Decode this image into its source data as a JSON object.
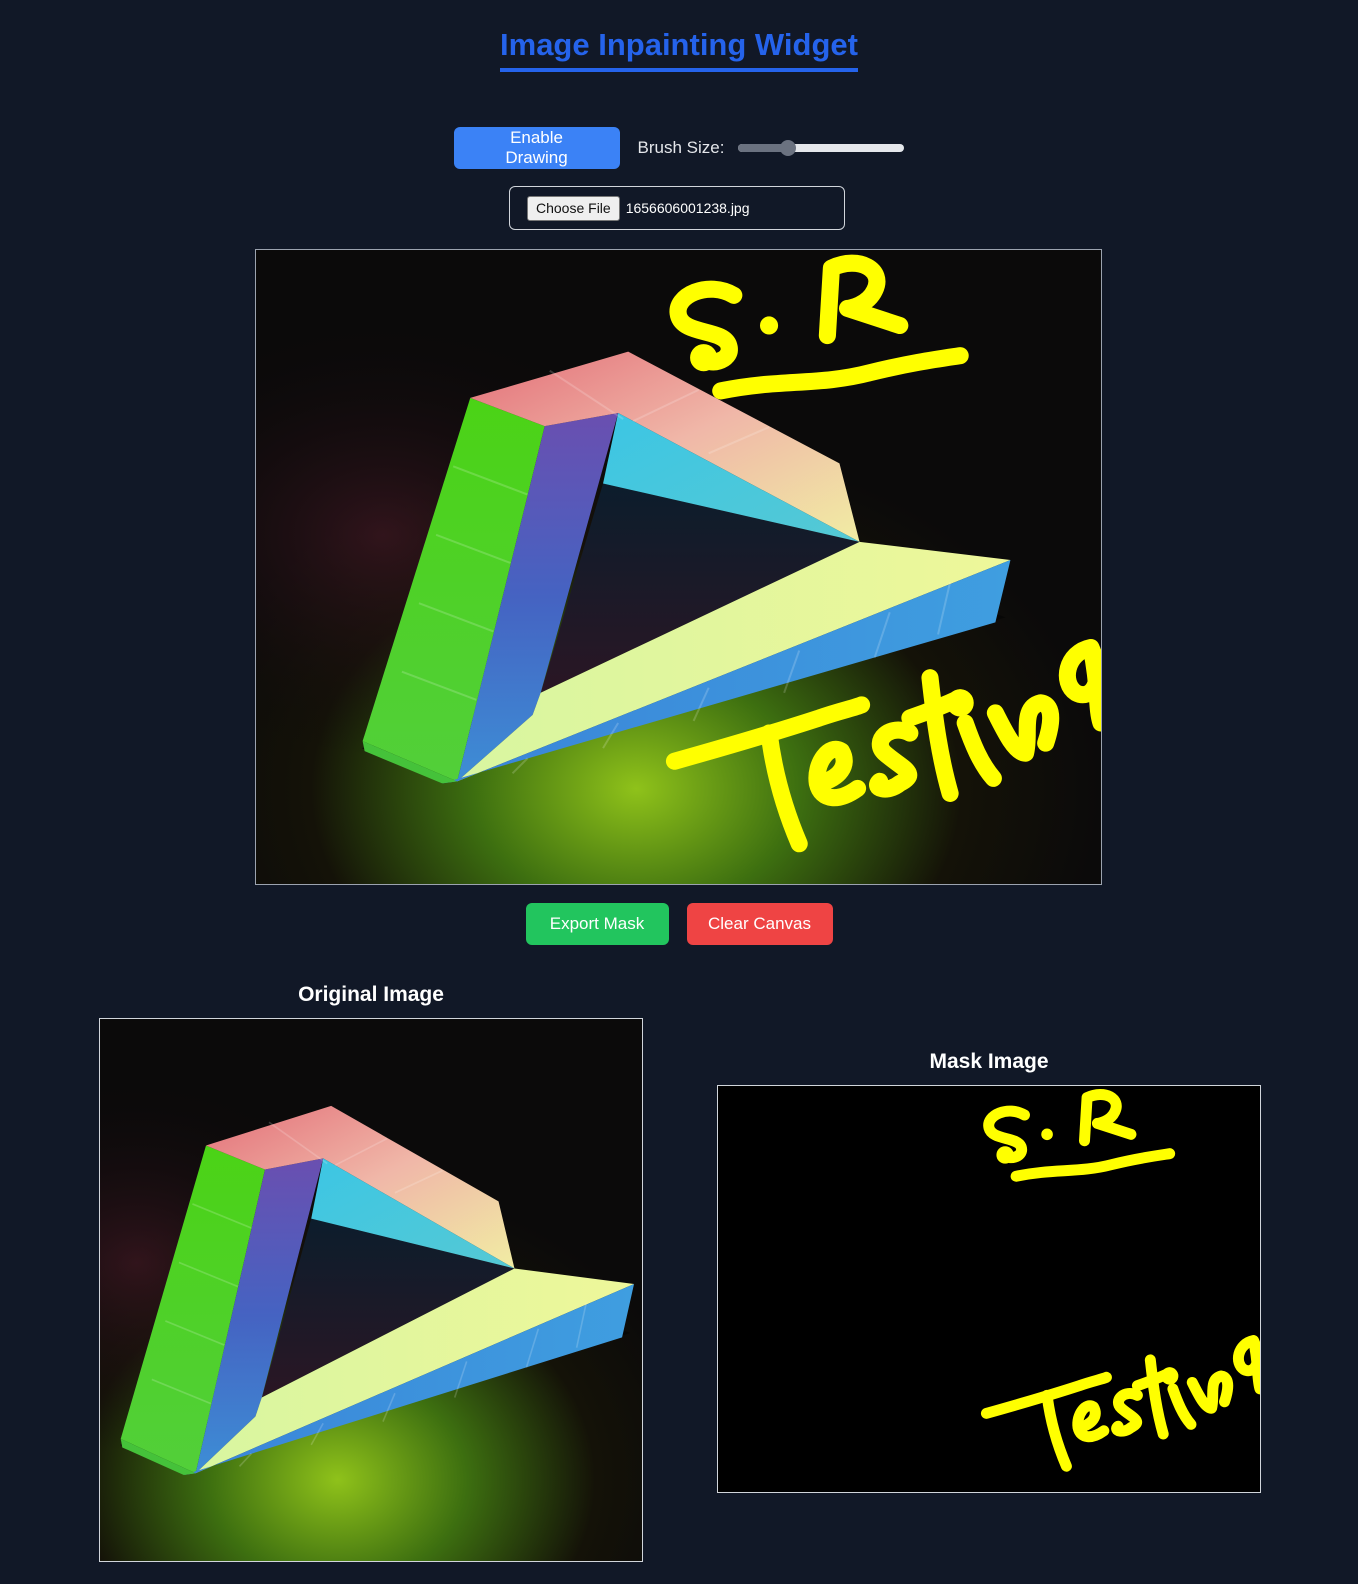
{
  "page": {
    "title": "Image Inpainting Widget"
  },
  "toolbar": {
    "enable_drawing_label": "Enable Drawing",
    "brush_size_label": "Brush Size:",
    "brush_size_fraction": 0.28
  },
  "file_input": {
    "button_label": "Choose File",
    "file_name": "1656606001238.jpg"
  },
  "canvas": {
    "drawn_text": [
      "S.R",
      "Testing"
    ],
    "stroke_color": "#ffff00"
  },
  "actions": {
    "export_label": "Export Mask",
    "clear_label": "Clear Canvas"
  },
  "previews": {
    "original_title": "Original Image",
    "mask_title": "Mask Image"
  },
  "colors": {
    "background": "#111827",
    "accent": "#2563eb",
    "primary_button": "#3b82f6",
    "export_button": "#22c55e",
    "clear_button": "#ef4444"
  }
}
